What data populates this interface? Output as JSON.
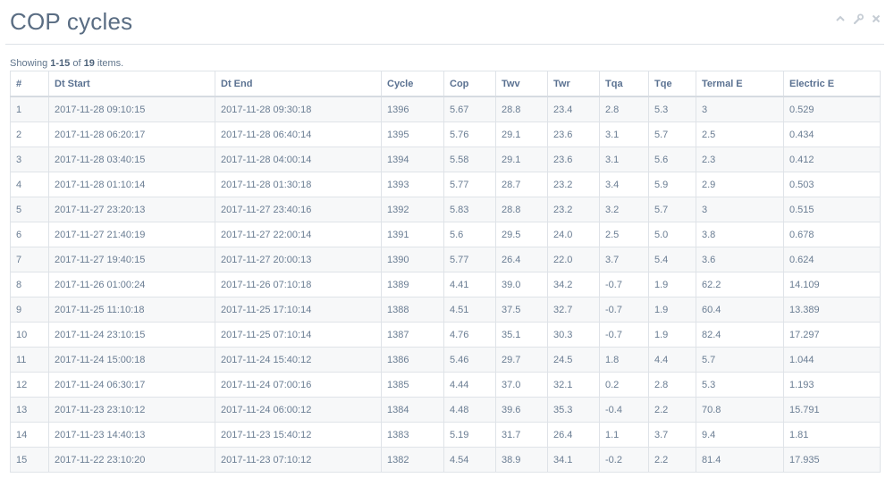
{
  "panel": {
    "title": "COP cycles"
  },
  "summary": {
    "prefix": "Showing ",
    "range": "1-15",
    "of": " of ",
    "total": "19",
    "suffix": " items."
  },
  "tools": {
    "collapse_icon": "chevron-up-icon",
    "settings_icon": "wrench-icon",
    "close_icon": "close-icon"
  },
  "table": {
    "columns": [
      "#",
      "Dt Start",
      "Dt End",
      "Cycle",
      "Cop",
      "Twv",
      "Twr",
      "Tqa",
      "Tqe",
      "Termal E",
      "Electric E"
    ],
    "rows": [
      [
        "1",
        "2017-11-28 09:10:15",
        "2017-11-28 09:30:18",
        "1396",
        "5.67",
        "28.8",
        "23.4",
        "2.8",
        "5.3",
        "3",
        "0.529"
      ],
      [
        "2",
        "2017-11-28 06:20:17",
        "2017-11-28 06:40:14",
        "1395",
        "5.76",
        "29.1",
        "23.6",
        "3.1",
        "5.7",
        "2.5",
        "0.434"
      ],
      [
        "3",
        "2017-11-28 03:40:15",
        "2017-11-28 04:00:14",
        "1394",
        "5.58",
        "29.1",
        "23.6",
        "3.1",
        "5.6",
        "2.3",
        "0.412"
      ],
      [
        "4",
        "2017-11-28 01:10:14",
        "2017-11-28 01:30:18",
        "1393",
        "5.77",
        "28.7",
        "23.2",
        "3.4",
        "5.9",
        "2.9",
        "0.503"
      ],
      [
        "5",
        "2017-11-27 23:20:13",
        "2017-11-27 23:40:16",
        "1392",
        "5.83",
        "28.8",
        "23.2",
        "3.2",
        "5.7",
        "3",
        "0.515"
      ],
      [
        "6",
        "2017-11-27 21:40:19",
        "2017-11-27 22:00:14",
        "1391",
        "5.6",
        "29.5",
        "24.0",
        "2.5",
        "5.0",
        "3.8",
        "0.678"
      ],
      [
        "7",
        "2017-11-27 19:40:15",
        "2017-11-27 20:00:13",
        "1390",
        "5.77",
        "26.4",
        "22.0",
        "3.7",
        "5.4",
        "3.6",
        "0.624"
      ],
      [
        "8",
        "2017-11-26 01:00:24",
        "2017-11-26 07:10:18",
        "1389",
        "4.41",
        "39.0",
        "34.2",
        "-0.7",
        "1.9",
        "62.2",
        "14.109"
      ],
      [
        "9",
        "2017-11-25 11:10:18",
        "2017-11-25 17:10:14",
        "1388",
        "4.51",
        "37.5",
        "32.7",
        "-0.7",
        "1.9",
        "60.4",
        "13.389"
      ],
      [
        "10",
        "2017-11-24 23:10:15",
        "2017-11-25 07:10:14",
        "1387",
        "4.76",
        "35.1",
        "30.3",
        "-0.7",
        "1.9",
        "82.4",
        "17.297"
      ],
      [
        "11",
        "2017-11-24 15:00:18",
        "2017-11-24 15:40:12",
        "1386",
        "5.46",
        "29.7",
        "24.5",
        "1.8",
        "4.4",
        "5.7",
        "1.044"
      ],
      [
        "12",
        "2017-11-24 06:30:17",
        "2017-11-24 07:00:16",
        "1385",
        "4.44",
        "37.0",
        "32.1",
        "0.2",
        "2.8",
        "5.3",
        "1.193"
      ],
      [
        "13",
        "2017-11-23 23:10:12",
        "2017-11-24 06:00:12",
        "1384",
        "4.48",
        "39.6",
        "35.3",
        "-0.4",
        "2.2",
        "70.8",
        "15.791"
      ],
      [
        "14",
        "2017-11-23 14:40:13",
        "2017-11-23 15:40:12",
        "1383",
        "5.19",
        "31.7",
        "26.4",
        "1.1",
        "3.7",
        "9.4",
        "1.81"
      ],
      [
        "15",
        "2017-11-22 23:10:20",
        "2017-11-23 07:10:12",
        "1382",
        "4.54",
        "38.9",
        "34.1",
        "-0.2",
        "2.2",
        "81.4",
        "17.935"
      ]
    ]
  }
}
